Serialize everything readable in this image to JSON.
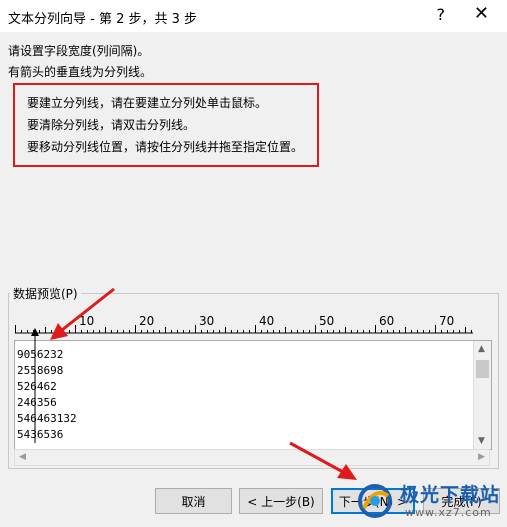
{
  "window": {
    "title": "文本分列向导 - 第 2 步，共 3 步",
    "help": "?",
    "close": "✕"
  },
  "description": {
    "line1": "请设置字段宽度(列间隔)。",
    "line2": "有箭头的垂直线为分列线。"
  },
  "instructions": [
    "要建立分列线，请在要建立分列处单击鼠标。",
    "要清除分列线，请双击分列线。",
    "要移动分列线位置，请按住分列线并拖至指定位置。"
  ],
  "preview": {
    "label": "数据预览(P)",
    "ruler_ticks": [
      "10",
      "20",
      "30",
      "40",
      "50",
      "60",
      "70"
    ],
    "rows": [
      "9056232",
      "2558698",
      "526462",
      "246356",
      "546463132",
      "5436536"
    ]
  },
  "buttons": {
    "cancel": "取消",
    "back": "< 上一步(B)",
    "next": "下一步(N) >",
    "finish": "完成(F)"
  },
  "watermark": {
    "brand": "极光下载站",
    "url": "www.xz7.com"
  },
  "colors": {
    "annotation_red": "#e0191b",
    "accent": "#0078d7"
  }
}
